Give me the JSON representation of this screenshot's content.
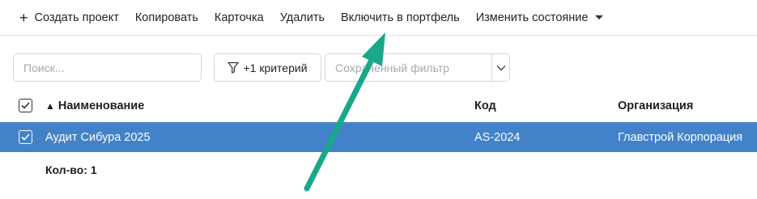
{
  "toolbar": {
    "create_label": "Создать проект",
    "copy_label": "Копировать",
    "card_label": "Карточка",
    "delete_label": "Удалить",
    "include_label": "Включить в портфель",
    "change_state_label": "Изменить состояние"
  },
  "filters": {
    "search_placeholder": "Поиск...",
    "criteria_label": "+1 критерий",
    "saved_filter_placeholder": "Сохраненный фильтр"
  },
  "table": {
    "sort_indicator": "▲",
    "columns": {
      "name": "Наименование",
      "code": "Код",
      "organization": "Организация"
    },
    "rows": [
      {
        "name": "Аудит Сибура 2025",
        "code": "AS-2024",
        "organization": "Главстрой Корпорация",
        "selected": true
      }
    ],
    "count_label": "Кол-во: 1"
  },
  "colors": {
    "selection": "#4282c8",
    "annotation_arrow": "#1aa88a"
  }
}
